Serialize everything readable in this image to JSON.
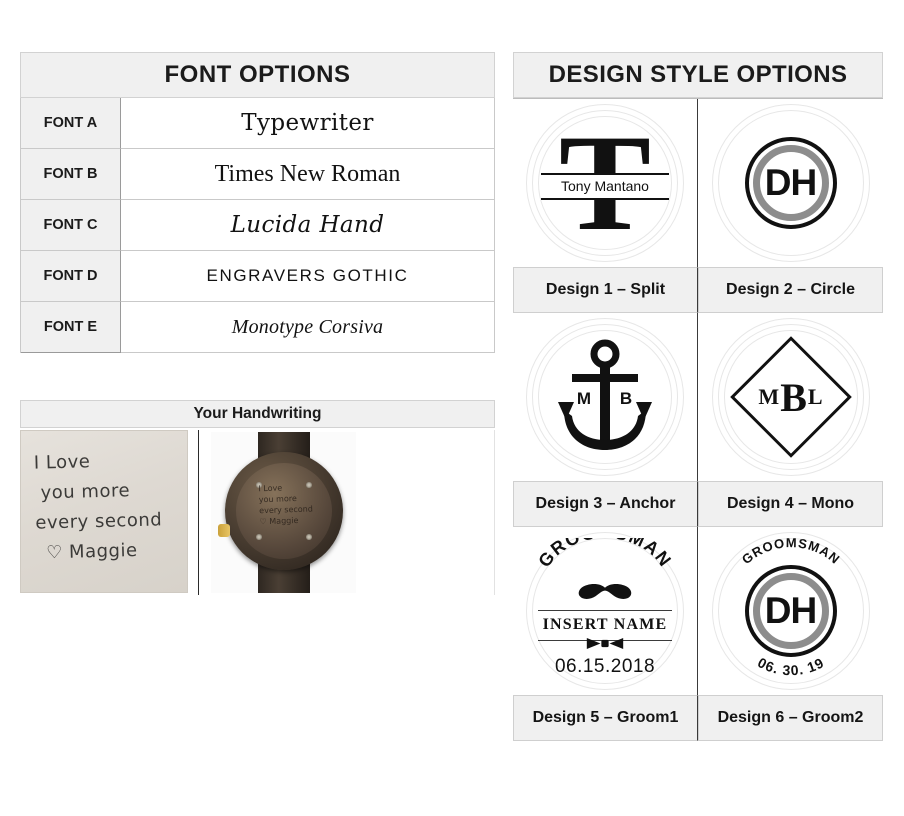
{
  "font_options": {
    "title": "FONT OPTIONS",
    "rows": [
      {
        "label": "FONT A",
        "sample": "Typewriter"
      },
      {
        "label": "FONT B",
        "sample": "Times New Roman"
      },
      {
        "label": "FONT C",
        "sample": "Lucida Hand"
      },
      {
        "label": "FONT D",
        "sample": "Engravers Gothic"
      },
      {
        "label": "FONT E",
        "sample": "Monotype Corsiva"
      }
    ]
  },
  "handwriting": {
    "title": "Your Handwriting",
    "note_lines": [
      "I Love",
      "you more",
      "every second",
      "♡ Maggie"
    ],
    "note_text": "I Love you more every second ♡ Maggie",
    "engraved_preview_alt": "wooden watch back engraved with handwriting"
  },
  "design_options": {
    "title": "DESIGN STYLE OPTIONS",
    "designs": [
      {
        "label": "Design 1 – Split",
        "art": "split-monogram",
        "initial": "T",
        "name": "Tony Mantano"
      },
      {
        "label": "Design 2 – Circle",
        "art": "circle-badge",
        "monogram": "DH"
      },
      {
        "label": "Design 3 – Anchor",
        "art": "anchor",
        "left_initial": "M",
        "right_initial": "B"
      },
      {
        "label": "Design 4 – Mono",
        "art": "diamond-monogram",
        "mono_left": "M",
        "mono_center": "B",
        "mono_right": "L"
      },
      {
        "label": "Design 5 – Groom1",
        "art": "groomsman-arch",
        "arc_text": "GROOMSMAN",
        "name_text": "INSERT NAME",
        "date": "06.15.2018",
        "icons": [
          "mustache-icon",
          "bowtie-icon"
        ]
      },
      {
        "label": "Design 6 – Groom2",
        "art": "groomsman-badge",
        "arc_text": "GROOMSMAN",
        "monogram": "DH",
        "date": "06. 30. 19"
      }
    ]
  },
  "colors": {
    "header_bg": "#f0f0f0",
    "border": "#cfcfcf",
    "divider": "#3a3a3a",
    "text": "#111111"
  }
}
